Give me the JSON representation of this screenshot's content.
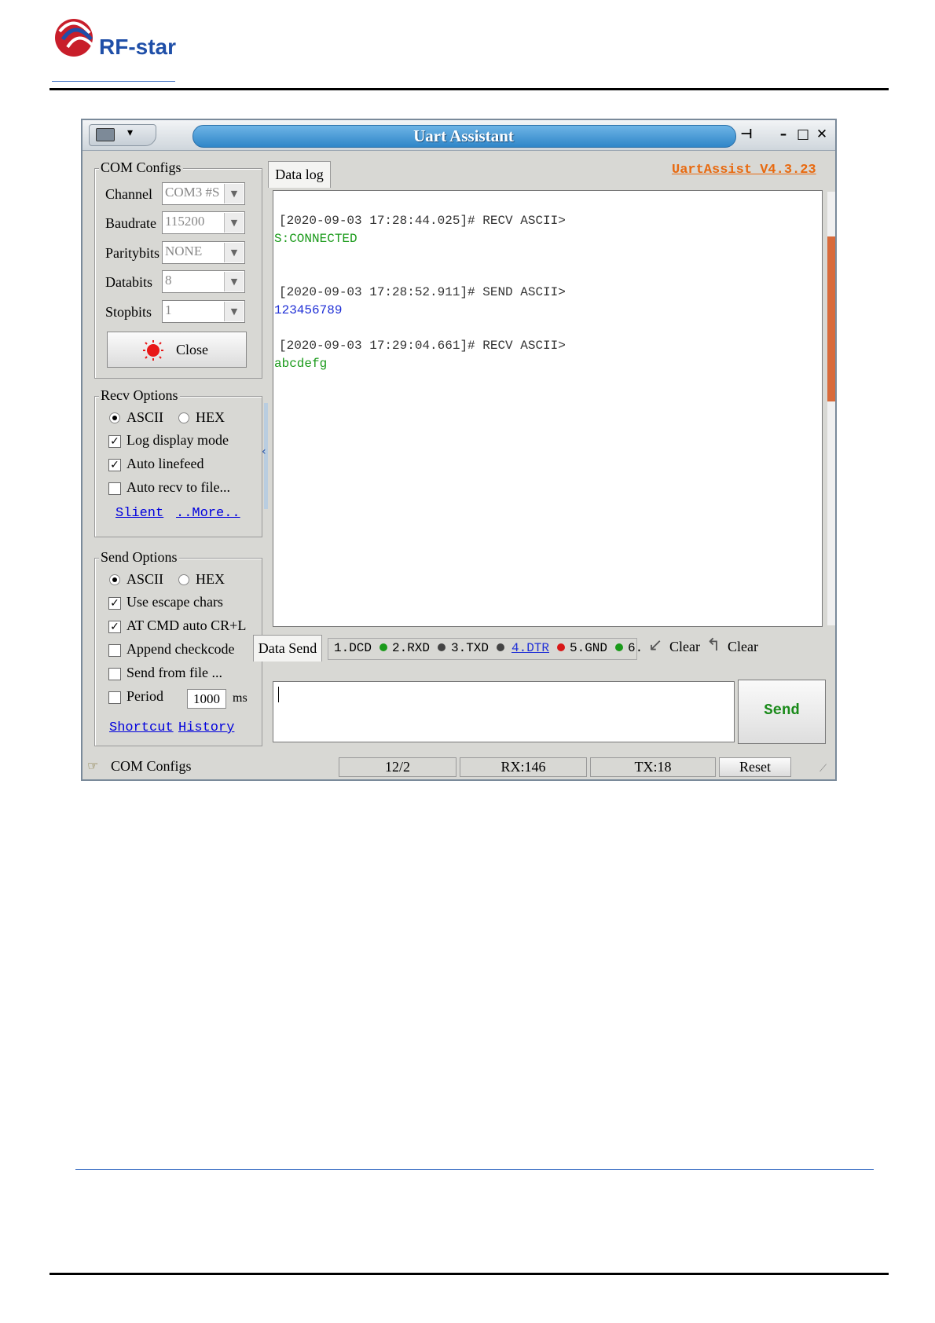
{
  "brand": {
    "logo_text": "RF-star",
    "logo_color": "#1f4fa8",
    "mark_color": "#c81e2a"
  },
  "window": {
    "title": "Uart Assistant",
    "version": "UartAssist V4.3.23",
    "left": {
      "com_configs": {
        "legend": "COM Configs",
        "channel": {
          "label": "Channel",
          "value": "COM3 #S"
        },
        "baudrate": {
          "label": "Baudrate",
          "value": "115200"
        },
        "paritybits": {
          "label": "Paritybits",
          "value": "NONE"
        },
        "databits": {
          "label": "Databits",
          "value": "8"
        },
        "stopbits": {
          "label": "Stopbits",
          "value": "1"
        },
        "close_label": "Close"
      },
      "recv_options": {
        "legend": "Recv Options",
        "ascii": "ASCII",
        "hex": "HEX",
        "log_display": "Log display mode",
        "auto_linefeed": "Auto linefeed",
        "auto_recv": "Auto recv to file...",
        "slient": "Slient",
        "more": "..More.."
      },
      "send_options": {
        "legend": "Send Options",
        "ascii": "ASCII",
        "hex": "HEX",
        "escape": "Use escape chars",
        "at_cmd": "AT CMD auto CR+L",
        "append": "Append checkcode",
        "from_file": "Send from file ...",
        "period": "Period",
        "period_value": "1000",
        "ms": "ms",
        "shortcut": "Shortcut",
        "history": "History"
      }
    },
    "log_tab": "Data log",
    "log": [
      {
        "header": "[2020-09-03 17:28:44.025]# RECV ASCII>",
        "body": "S:CONNECTED",
        "color": "#1a9a1a"
      },
      {
        "header": "[2020-09-03 17:28:52.911]# SEND ASCII>",
        "body": "123456789",
        "color": "#1f2fd6"
      },
      {
        "header": "[2020-09-03 17:29:04.661]# RECV ASCII>",
        "body": "abcdefg",
        "color": "#1a9a1a"
      }
    ],
    "send_tab": "Data Send",
    "signals": [
      {
        "label": "1.DCD",
        "color": "#1a9a1a"
      },
      {
        "label": "2.RXD",
        "color": "#444444"
      },
      {
        "label": "3.TXD",
        "color": "#444444"
      },
      {
        "label": "4.DTR",
        "color": "#d81818"
      },
      {
        "label": "5.GND",
        "color": "#1a9a1a"
      },
      {
        "label": "6.",
        "color": ""
      }
    ],
    "clear1": "Clear",
    "clear2": "Clear",
    "send_label": "Send",
    "status": {
      "com": "COM Configs",
      "count": "12/2",
      "rx": "RX:146",
      "tx": "TX:18",
      "reset": "Reset"
    }
  }
}
